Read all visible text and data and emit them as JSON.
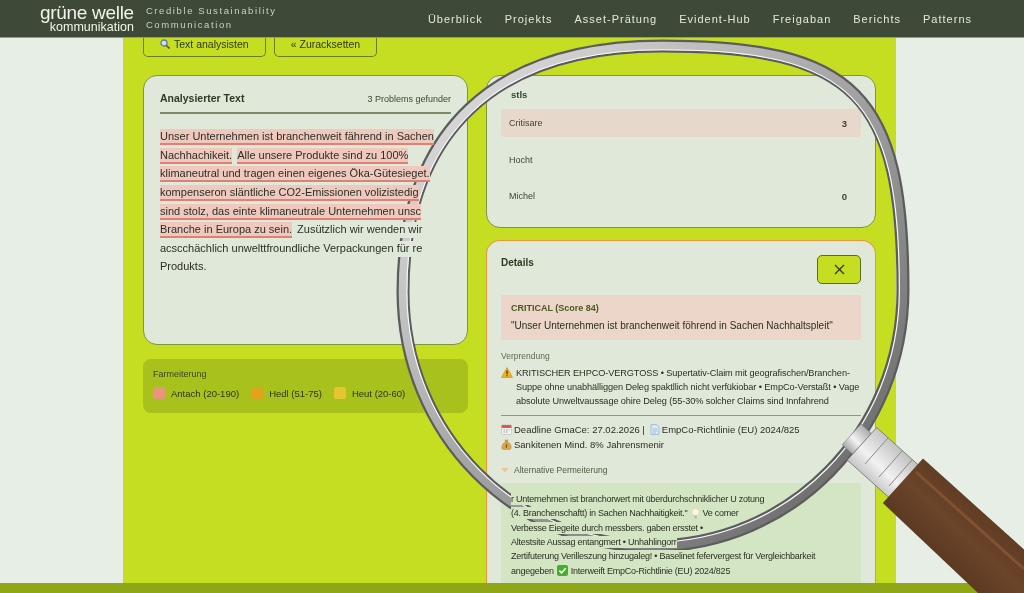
{
  "nav": {
    "logo": {
      "name": "grüne welle",
      "subline": "kommunikation"
    },
    "tagline": [
      "Credible Sustainability",
      "Communication"
    ],
    "items": [
      "Überblick",
      "Projekts",
      "Asset-Prätung",
      "Evident-Hub",
      "Freigaban",
      "Berichts",
      "Patterns"
    ]
  },
  "toolbar": {
    "buttons": [
      {
        "kind": "icon",
        "label": "Text analysisten"
      },
      {
        "kind": "text",
        "label": "« Zuracksetten"
      }
    ]
  },
  "analysis": {
    "title": "Analysierter Text",
    "count": "3 Problems gefunder",
    "lines": [
      [
        {
          "text": "Unser Unternehmen ist branchenweit fährend in Sachen",
          "flagged": true
        }
      ],
      [
        {
          "text": "Nachhachikeit.",
          "flagged": true
        },
        {
          "text": "Alle unsere Produkte sind zu 100%",
          "flagged": true
        }
      ],
      [
        {
          "text": "klimaneutral und tragen einen eigenes Öka-Gütesieget.",
          "flagged": true
        }
      ],
      [
        {
          "text": "kompenseron släntliche CO2-Emissionen volizistedig",
          "flagged": true
        }
      ],
      [
        {
          "text": "sind stolz, das einte klimaneutrale Unternehmen unsc",
          "flagged": true
        }
      ],
      [
        {
          "text": "Branche in Europa zu sein.",
          "flagged": true
        },
        {
          "text": "Zusützlich wir wenden wir",
          "flagged": false
        }
      ],
      [
        {
          "text": "acscchächlich unwelttfroundliche Verpackungen für re",
          "flagged": false
        }
      ],
      [
        {
          "text": "Produkts.",
          "flagged": false
        }
      ]
    ]
  },
  "legend": {
    "title": "Farmeiterung",
    "items": [
      {
        "label": "Antach (20-190)",
        "color": "#e8957a"
      },
      {
        "label": "Hedl (51-75)",
        "color": "#e2a21c"
      },
      {
        "label": "Heut (20-60)",
        "color": "#e6c532"
      }
    ]
  },
  "stats": {
    "title": "stls",
    "rows": [
      {
        "label": "Critisare",
        "count": "3",
        "selected": true
      },
      {
        "label": "Hocht",
        "selected": false
      },
      {
        "label": "Michel",
        "count": "0",
        "selected": false
      }
    ]
  },
  "details": {
    "title": "Details",
    "finding": {
      "severity": "CRITICAL (Score 84)",
      "quote": "\"Unser Unternehmen ist branchenweit föhrend in Sachen Nachhaltspleit\""
    },
    "reason": {
      "label": "Verprendung",
      "text": "KRITISCHER EHPCO-VERGTOSS • Supertativ-Claim mit geografischen/Branchen-Suppe ohne unabhälliggen Deleg spaktllich nicht verfükiobar • EmpCo-Verstaßt • Vage absolute Unweltvaussage ohire Deleg (55-30% solcher Claims sind Innfahrend"
    },
    "meta": [
      "Deadline GmaCe: 27.02.2026 |",
      "EmpCo-Richtlinie (EU) 2024/825",
      "Sankitenen Mind. 8% Jahrensmenir"
    ],
    "alternative": {
      "label": "Alternative Permeiterung",
      "expanded": true,
      "lines": [
        [
          {
            "kind": "text",
            "text": "r Unternehmen ist branchorwert mit überdurchschniklicher U zotung"
          }
        ],
        [
          {
            "kind": "text",
            "text": "(4. Branchenschaftt) in Sachen Nachhaitigkeit.\""
          },
          {
            "kind": "tip",
            "text": "Ve comer"
          }
        ],
        [
          {
            "kind": "text",
            "text": "Verbesse Eiegeite durch messbers. gaben ersstet •"
          }
        ],
        [
          {
            "kind": "text",
            "text": "Altestsite Aussag entangmert • Unhahlingorr"
          }
        ],
        [
          {
            "kind": "text",
            "text": "Zertifuterung Verilleszung hinzugaleg! • Baselinet fefervergest für Vergleichbarkeit"
          }
        ],
        [
          {
            "kind": "text",
            "text": "angegeben"
          },
          {
            "kind": "verified",
            "text": "Interweift EmpCo-Richtlinie (EU) 2024/825"
          }
        ]
      ]
    }
  }
}
